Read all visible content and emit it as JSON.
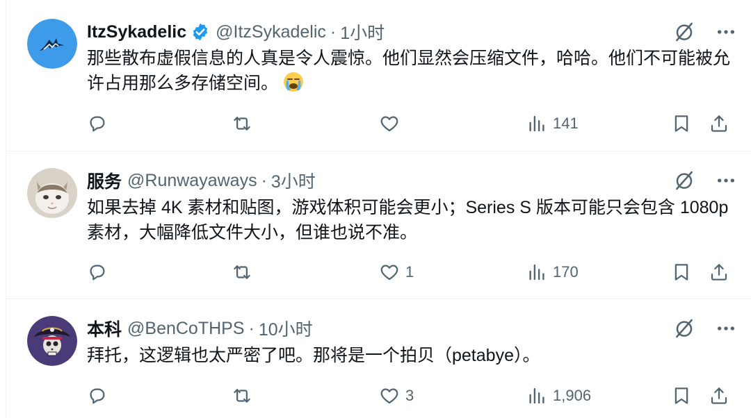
{
  "tweets": [
    {
      "name": "ItzSykadelic",
      "verified": true,
      "handle": "@ItzSykadelic",
      "separator": "·",
      "time": "1小时",
      "text": "那些散布虚假信息的人真是令人震惊。他们显然会压缩文件，哈哈。他们不可能被允许占用那么多存储空间。",
      "emoji": "loudly-crying-face-emoji",
      "avatar": "wolf-logo-avatar",
      "avatar_color": "#3d9be9",
      "stats": {
        "replies": "",
        "retweets": "",
        "likes": "",
        "views": "141"
      }
    },
    {
      "name": "服务",
      "verified": false,
      "handle": "@Runwayaways",
      "separator": "·",
      "time": "3小时",
      "text": "如果去掉 4K 素材和贴图，游戏体积可能会更小；Series S 版本可能只会包含 1080p 素材，大幅降低文件大小，但谁也说不准。",
      "avatar": "kitten-avatar",
      "stats": {
        "replies": "",
        "retweets": "",
        "likes": "1",
        "views": "170"
      }
    },
    {
      "name": "本科",
      "verified": false,
      "handle": "@BenCoTHPS",
      "separator": "·",
      "time": "10小时",
      "text": "拜托，这逻辑也太严密了吧。那将是一个拍贝（petabye）。",
      "avatar": "pirate-skull-avatar",
      "stats": {
        "replies": "",
        "retweets": "",
        "likes": "3",
        "views": "1,906"
      }
    }
  ],
  "colors": {
    "text": "#0f1419",
    "secondary": "#536471",
    "verified_blue": "#1d9bf0",
    "divider": "#eff3f4"
  },
  "icons": {
    "reply": "reply-icon",
    "retweet": "retweet-icon",
    "like": "heart-icon",
    "views": "views-icon",
    "bookmark": "bookmark-icon",
    "share": "share-icon",
    "grok": "grok-icon",
    "more": "more-icon"
  }
}
